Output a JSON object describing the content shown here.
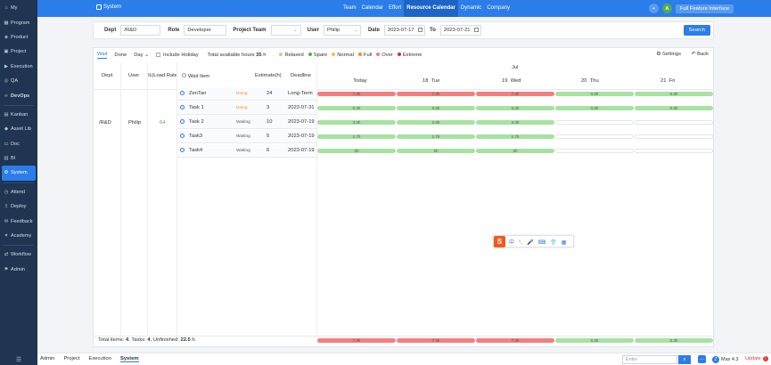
{
  "sidebar": {
    "items": [
      {
        "label": "My",
        "icon": "home-icon"
      },
      {
        "label": "Program",
        "icon": "program-icon"
      },
      {
        "label": "Product",
        "icon": "product-icon"
      },
      {
        "label": "Project",
        "icon": "project-icon"
      },
      {
        "label": "Execution",
        "icon": "execution-icon"
      },
      {
        "label": "QA",
        "icon": "qa-icon"
      },
      {
        "label": "DevOps",
        "icon": "devops-icon"
      },
      {
        "label": "Kanban",
        "icon": "kanban-icon"
      },
      {
        "label": "Asset Lib",
        "icon": "asset-icon"
      },
      {
        "label": "Doc",
        "icon": "doc-icon"
      },
      {
        "label": "BI",
        "icon": "bi-icon"
      },
      {
        "label": "System",
        "icon": "system-icon"
      },
      {
        "label": "Attend",
        "icon": "attend-icon"
      },
      {
        "label": "Deploy",
        "icon": "deploy-icon"
      },
      {
        "label": "Feedback",
        "icon": "feedback-icon"
      },
      {
        "label": "Academy",
        "icon": "academy-icon"
      },
      {
        "label": "Workflow",
        "icon": "workflow-icon"
      },
      {
        "label": "Admin",
        "icon": "admin-icon"
      }
    ],
    "menu_glyph": "☰"
  },
  "topbar": {
    "crumb": "System",
    "nav": [
      "Team",
      "Calendar",
      "Effort",
      "Resource Calendar",
      "Dynamic",
      "Company"
    ],
    "avatar": "A",
    "plus": "+",
    "full_feature": "Full Feature Interface"
  },
  "filter": {
    "dept_label": "Dept",
    "dept_value": "/R&D",
    "role_label": "Role",
    "role_value": "Developer",
    "team_label": "Project Team",
    "team_value": "",
    "user_label": "User",
    "user_value": "Philip",
    "date_label": "Date",
    "date_from": "2023-07-17",
    "to_label": "To",
    "date_to": "2023-07-21",
    "search": "Search"
  },
  "toolbar": {
    "tab_wait": "Wait",
    "tab_done": "Done",
    "tab_day": "Day",
    "include_holiday": "Include Holiday",
    "hours_prefix": "Total available hours",
    "hours_value": "35",
    "hours_unit": "h",
    "legend": [
      {
        "label": "Relaxed",
        "color": "#a6e2a0"
      },
      {
        "label": "Spare",
        "color": "#4caf50"
      },
      {
        "label": "Normal",
        "color": "#f5c342"
      },
      {
        "label": "Full",
        "color": "#f08c2e"
      },
      {
        "label": "Over",
        "color": "#f47f7f"
      },
      {
        "label": "Extreme",
        "color": "#d32f2f"
      }
    ],
    "settings": "Settings",
    "back": "Back"
  },
  "table": {
    "headers": {
      "dept": "Dept",
      "user": "User",
      "load": "Load Rate(%",
      "wait_item": "Wait Item",
      "estimate": "Estimate(h)",
      "deadline": "Deadline"
    },
    "dept": "/R&D",
    "user": "Philip",
    "load": "64",
    "rows": [
      {
        "name": "ZenTao",
        "status": "Doing",
        "estimate": "24",
        "deadline": "Long-Term"
      },
      {
        "name": "Task 1",
        "status": "Doing",
        "estimate": "3",
        "deadline": "2023-07-31"
      },
      {
        "name": "Task 2",
        "status": "Waiting",
        "estimate": "10",
        "deadline": "2023-07-19"
      },
      {
        "name": "Task3",
        "status": "Waiting",
        "estimate": "5",
        "deadline": "2023-07-19"
      },
      {
        "name": "Task4",
        "status": "Waiting",
        "estimate": "6",
        "deadline": "2023-07-19"
      }
    ]
  },
  "timeline": {
    "month": "Jul",
    "days": [
      {
        "num": "",
        "name": "Today"
      },
      {
        "num": "18",
        "name": "Tue"
      },
      {
        "num": "19",
        "name": "Wed"
      },
      {
        "num": "20",
        "name": "Thu"
      },
      {
        "num": "21",
        "name": "Fri"
      }
    ],
    "rows": [
      [
        "7.3h",
        "7.3h",
        "7.3h",
        "0.3h",
        "0.3h"
      ],
      [
        "0.3h",
        "0.3h",
        "0.3h",
        "0.3h",
        "0.3h"
      ],
      [
        "3.3h",
        "3.3h",
        "3.3h",
        "",
        ""
      ],
      [
        "1.7h",
        "1.7h",
        "1.7h",
        "",
        ""
      ],
      [
        "2h",
        "2h",
        "2h",
        "",
        ""
      ]
    ],
    "totals": [
      "7.3h",
      "7.3h",
      "7.3h",
      "0.3h",
      "0.3h"
    ]
  },
  "footer": {
    "total_items_label": "Total items:",
    "total_items": "4",
    "tasks_label": "Tasks:",
    "tasks": "4",
    "unfinished_label": "Unfinished:",
    "unfinished": "22.5",
    "unit": "h."
  },
  "ime": {
    "logo": "S",
    "glyphs": [
      "中",
      "°,",
      "🎤",
      "⌨",
      "👕",
      "▦"
    ]
  },
  "bottombar": {
    "tabs": [
      "Admin",
      "Project",
      "Execution",
      "System"
    ],
    "enter_placeholder": "Enter",
    "version": "Max 4.3",
    "update": "Update"
  }
}
